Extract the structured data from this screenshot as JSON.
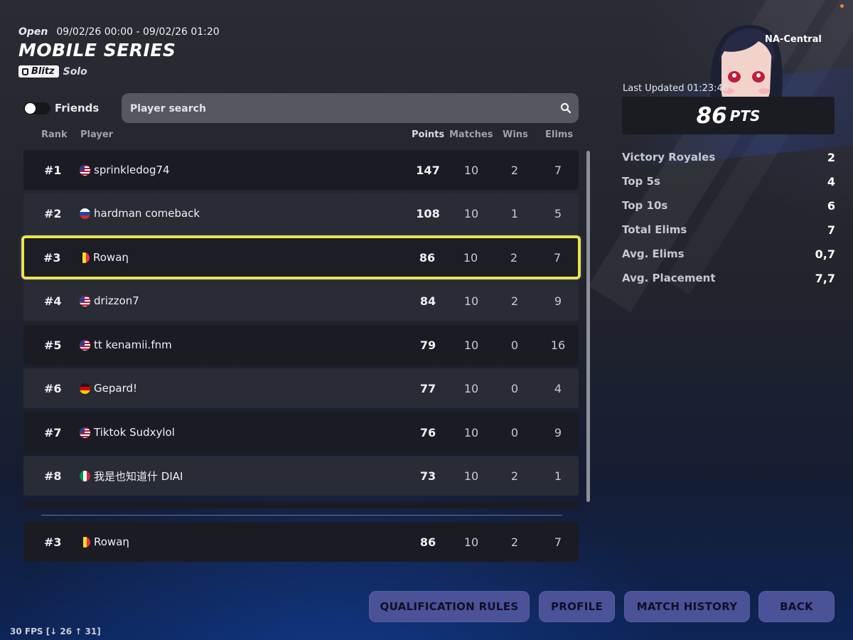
{
  "event": {
    "status": "Open",
    "dates": "09/02/26 00:00 - 09/02/26 01:20",
    "title": "MOBILE SERIES",
    "mode_badge": "Blitz",
    "mode_sub": "Solo"
  },
  "friends_toggle": {
    "label": "Friends",
    "on": false
  },
  "search": {
    "placeholder": "Player search",
    "value": ""
  },
  "columns": {
    "rank": "Rank",
    "player": "Player",
    "points": "Points",
    "matches": "Matches",
    "wins": "Wins",
    "elims": "Elims"
  },
  "rows": [
    {
      "rank": "#1",
      "flag": "us",
      "player": "sprinkledog74",
      "points": "147",
      "matches": "10",
      "wins": "2",
      "elims": "7"
    },
    {
      "rank": "#2",
      "flag": "ru",
      "player": "hardman comeback",
      "points": "108",
      "matches": "10",
      "wins": "1",
      "elims": "5"
    },
    {
      "rank": "#3",
      "flag": "be",
      "player": "Rowaη",
      "points": "86",
      "matches": "10",
      "wins": "2",
      "elims": "7"
    },
    {
      "rank": "#4",
      "flag": "us",
      "player": "drizzon7",
      "points": "84",
      "matches": "10",
      "wins": "2",
      "elims": "9"
    },
    {
      "rank": "#5",
      "flag": "us",
      "player": "tt kenamii.fnm",
      "points": "79",
      "matches": "10",
      "wins": "0",
      "elims": "16"
    },
    {
      "rank": "#6",
      "flag": "de",
      "player": "Gepard!",
      "points": "77",
      "matches": "10",
      "wins": "0",
      "elims": "4"
    },
    {
      "rank": "#7",
      "flag": "us",
      "player": "Tiktok Sudxylol",
      "points": "76",
      "matches": "10",
      "wins": "0",
      "elims": "9"
    },
    {
      "rank": "#8",
      "flag": "it",
      "player": "我是也知道什 DIAI",
      "points": "73",
      "matches": "10",
      "wins": "2",
      "elims": "1"
    }
  ],
  "self_row": {
    "rank": "#3",
    "flag": "be",
    "player": "Rowaη",
    "points": "86",
    "matches": "10",
    "wins": "2",
    "elims": "7"
  },
  "panel": {
    "region": "NA-Central",
    "last_updated": "Last Updated 01:23:40",
    "points_value": "86",
    "points_unit": "PTS",
    "stats": [
      {
        "label": "Victory Royales",
        "value": "2"
      },
      {
        "label": "Top 5s",
        "value": "4"
      },
      {
        "label": "Top 10s",
        "value": "6"
      },
      {
        "label": "Total Elims",
        "value": "7"
      },
      {
        "label": "Avg. Elims",
        "value": "0,7"
      },
      {
        "label": "Avg. Placement",
        "value": "7,7"
      }
    ]
  },
  "buttons": {
    "qualification_rules": "QUALIFICATION RULES",
    "profile": "PROFILE",
    "match_history": "MATCH HISTORY",
    "back": "BACK"
  },
  "fps_counter": "30 FPS [↓ 26 ↑ 31]",
  "icons": {
    "search": "search-icon",
    "mode": "bag-icon",
    "avatar": "character-avatar"
  }
}
